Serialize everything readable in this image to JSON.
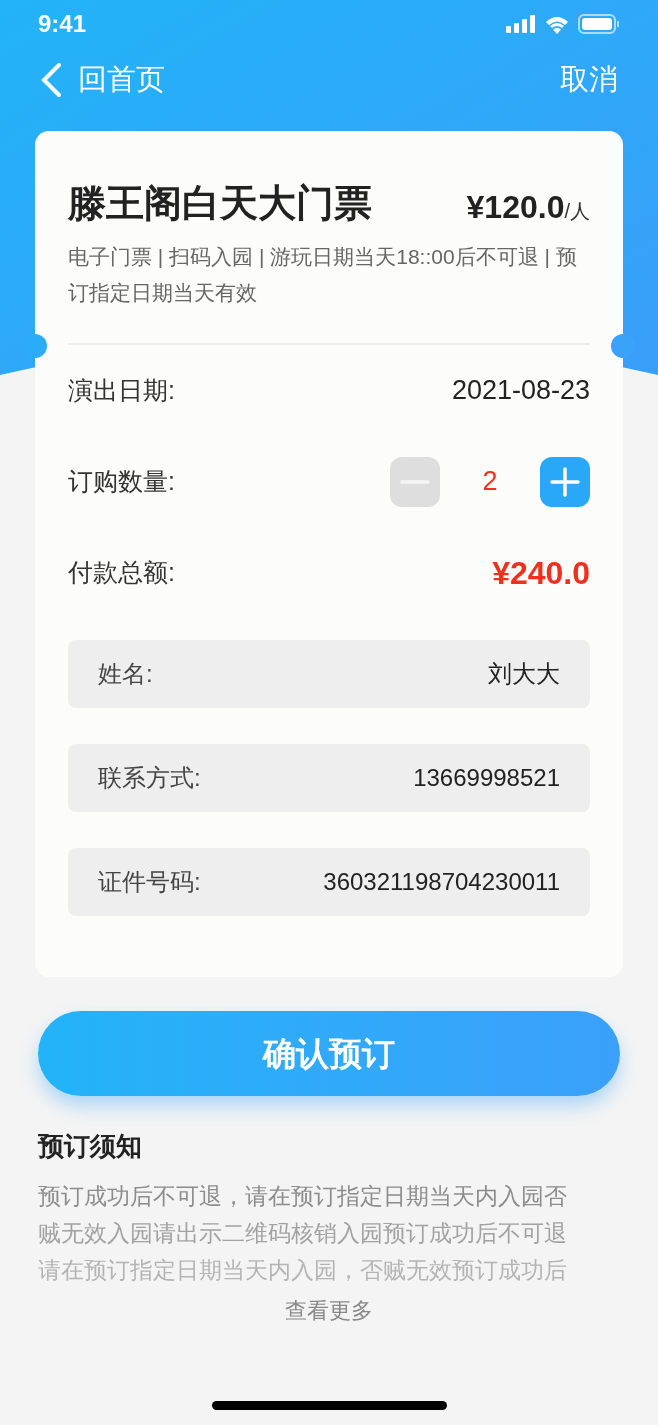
{
  "status_bar": {
    "time": "9:41"
  },
  "nav": {
    "back_label": "回首页",
    "action": "取消"
  },
  "ticket": {
    "title": "滕王阁白天大门票",
    "price": "¥120.0",
    "price_unit": "/人",
    "description": "电子门票 | 扫码入园 | 游玩日期当天18::00后不可退 | 预订指定日期当天有效"
  },
  "details": [
    {
      "kind": "text",
      "label": "演出日期:",
      "value": "2021-08-23"
    },
    {
      "kind": "stepper",
      "label": "订购数量:",
      "value": "2",
      "minus_disabled": true,
      "plus_disabled": false
    },
    {
      "kind": "total",
      "label": "付款总额:",
      "value": "¥240.0"
    }
  ],
  "fields": [
    {
      "label": "姓名:",
      "value": "刘大大"
    },
    {
      "label": "联系方式:",
      "value": "13669998521"
    },
    {
      "label": "证件号码:",
      "value": "360321198704230011"
    }
  ],
  "confirm_button": "确认预订",
  "notice": {
    "title": "预订须知",
    "lines": [
      "预订成功后不可退，请在预订指定日期当天内入园否",
      "贼无效入园请出示二维码核销入园预订成功后不可退",
      "请在预订指定日期当天内入园，否贼无效预订成功后"
    ],
    "more": "查看更多"
  }
}
